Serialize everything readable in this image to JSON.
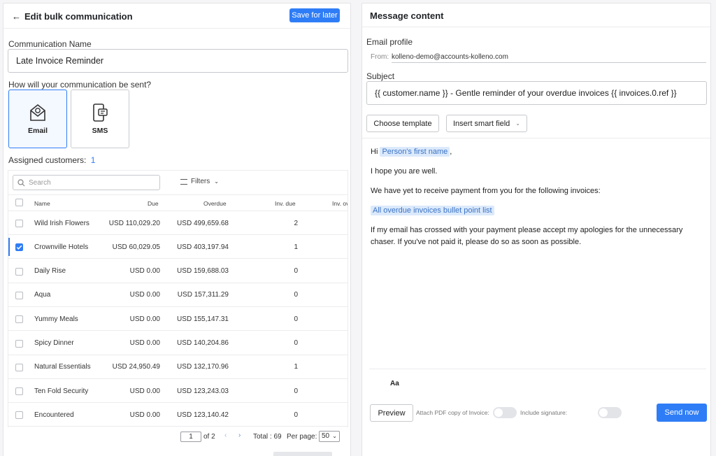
{
  "left": {
    "title": "Edit bulk communication",
    "save_later": "Save for later",
    "comm_name_label": "Communication Name",
    "comm_name_value": "Late Invoice Reminder",
    "how_sent_label": "How will your communication be sent?",
    "channels": [
      {
        "label": "Email",
        "icon": "email-icon",
        "selected": true
      },
      {
        "label": "SMS",
        "icon": "sms-icon",
        "selected": false
      }
    ],
    "assigned_label": "Assigned customers:",
    "assigned_count": "1",
    "search_placeholder": "Search",
    "filters_label": "Filters",
    "columns": [
      "Name",
      "Due",
      "Overdue",
      "Inv. due",
      "Inv. ov"
    ],
    "rows": [
      {
        "name": "Wild Irish Flowers",
        "due": "USD 110,029.20",
        "overdue": "USD 499,659.68",
        "inv_due": "2",
        "checked": false
      },
      {
        "name": "Crownville Hotels",
        "due": "USD 60,029.05",
        "overdue": "USD 403,197.94",
        "inv_due": "1",
        "checked": true
      },
      {
        "name": "Daily Rise",
        "due": "USD 0.00",
        "overdue": "USD 159,688.03",
        "inv_due": "0",
        "checked": false
      },
      {
        "name": "Aqua",
        "due": "USD 0.00",
        "overdue": "USD 157,311.29",
        "inv_due": "0",
        "checked": false
      },
      {
        "name": "Yummy Meals",
        "due": "USD 0.00",
        "overdue": "USD 155,147.31",
        "inv_due": "0",
        "checked": false
      },
      {
        "name": "Spicy Dinner",
        "due": "USD 0.00",
        "overdue": "USD 140,204.86",
        "inv_due": "0",
        "checked": false
      },
      {
        "name": "Natural Essentials",
        "due": "USD 24,950.49",
        "overdue": "USD 132,170.96",
        "inv_due": "1",
        "checked": false
      },
      {
        "name": "Ten Fold Security",
        "due": "USD 0.00",
        "overdue": "USD 123,243.03",
        "inv_due": "0",
        "checked": false
      },
      {
        "name": "Encountered",
        "due": "USD 0.00",
        "overdue": "USD 123,140.42",
        "inv_due": "0",
        "checked": false
      }
    ],
    "pagination": {
      "page": "1",
      "of_label": "of 2",
      "total_label": "Total : 69",
      "per_page_label": "Per page:",
      "per_page_value": "50"
    }
  },
  "right": {
    "title": "Message content",
    "email_profile_label": "Email profile",
    "from_label": "From:",
    "from_value": "kolleno-demo@accounts-kolleno.com",
    "subject_label": "Subject",
    "subject_value": "{{ customer.name }} - Gentle reminder of your overdue invoices {{ invoices.0.ref }}",
    "choose_template": "Choose template",
    "insert_smart_field": "Insert smart field",
    "body": {
      "hi": "Hi",
      "first_name_chip": "Person's first name",
      "comma": ",",
      "p1": "I hope you are well.",
      "p2": "We have yet to receive payment from you for the following invoices:",
      "invoices_chip": "All overdue invoices bullet point list",
      "p3": "If my email has crossed with your payment please accept my apologies for the unnecessary chaser. If you've not paid it, please do so as soon as possible."
    },
    "format_label": "Aa",
    "preview": "Preview",
    "attach_pdf_label": "Attach PDF copy of Invoice:",
    "include_sig_label": "Include signature:",
    "send_now": "Send now"
  },
  "colors": {
    "accent": "#2f7df6",
    "chip_bg": "#dbe9fb",
    "chip_text": "#3a73c4"
  }
}
